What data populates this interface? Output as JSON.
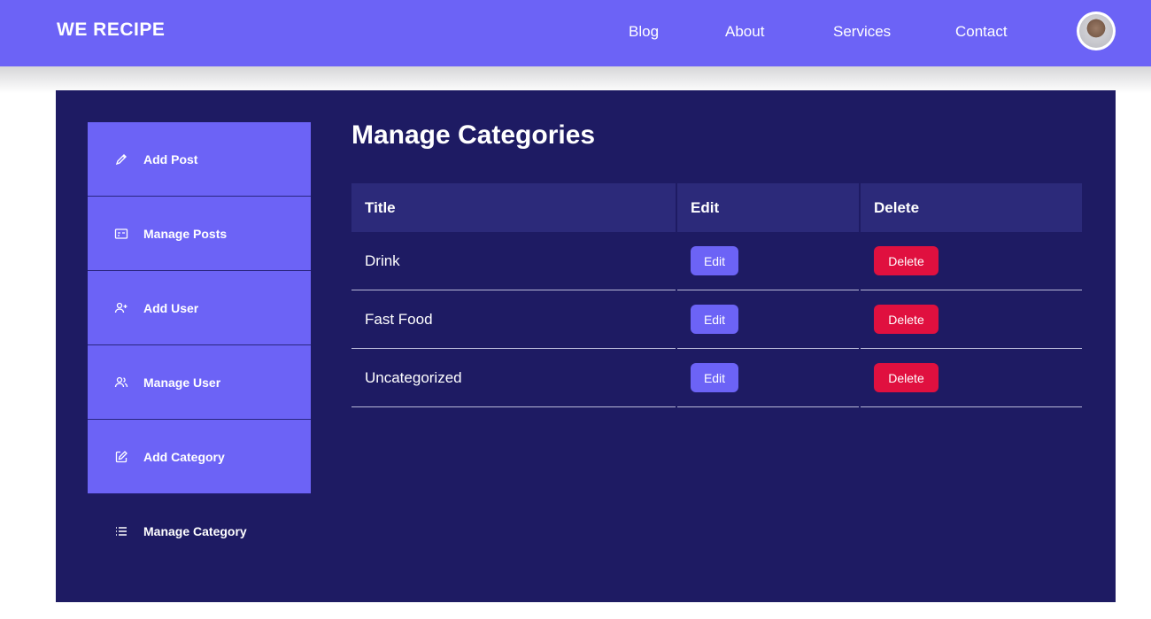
{
  "navbar": {
    "brand": "WE RECIPE",
    "links": [
      "Blog",
      "About",
      "Services",
      "Contact"
    ]
  },
  "sidebar": {
    "items": [
      {
        "label": "Add Post",
        "icon": "pencil-icon"
      },
      {
        "label": "Manage Posts",
        "icon": "card-icon"
      },
      {
        "label": "Add User",
        "icon": "user-plus-icon"
      },
      {
        "label": "Manage User",
        "icon": "users-icon"
      },
      {
        "label": "Add Category",
        "icon": "edit-square-icon"
      },
      {
        "label": "Manage Category",
        "icon": "list-icon"
      }
    ]
  },
  "main": {
    "title": "Manage Categories",
    "table": {
      "headers": [
        "Title",
        "Edit",
        "Delete"
      ],
      "rows": [
        {
          "title": "Drink",
          "edit": "Edit",
          "delete": "Delete"
        },
        {
          "title": "Fast Food",
          "edit": "Edit",
          "delete": "Delete"
        },
        {
          "title": "Uncategorized",
          "edit": "Edit",
          "delete": "Delete"
        }
      ]
    }
  },
  "colors": {
    "accent": "#6c63f6",
    "panel": "#1e1b63",
    "header_cell": "#2c2a7a",
    "danger": "#e0103f"
  }
}
